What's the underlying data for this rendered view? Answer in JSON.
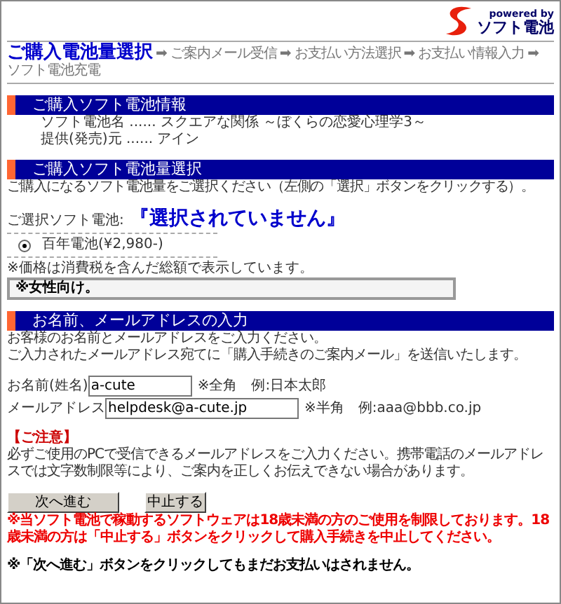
{
  "logo": {
    "tagline": "powered by",
    "name": "ソフト電池"
  },
  "breadcrumb": [
    {
      "label": "ご購入電池量選択",
      "selected": true
    },
    {
      "label": "ご案内メール受信",
      "selected": false,
      "arrow": "➡"
    },
    {
      "label": "お支払い方法選択",
      "selected": false,
      "arrow": "➡"
    },
    {
      "label": "お支払い情報入力",
      "selected": false,
      "arrow": "➡"
    },
    {
      "label": "ソフト電池充電",
      "selected": false,
      "arrow": "➡"
    }
  ],
  "product_info": {
    "title": "ご購入ソフト電池情報",
    "lines": [
      "ソフト電池名 ...... スクエアな関係 ～ぼくらの恋愛心理学3～",
      "提供(発売)元 ...... アイン"
    ]
  },
  "amount_selection": {
    "title": "ご購入ソフト電池量選択",
    "instruction": "ご購入になるソフト電池量をご選択ください（左側の「選択」ボタンをクリックする）。",
    "selected_label": "ご選択ソフト電池:",
    "selected_value": "『選択されていません』",
    "options": [
      {
        "label": "百年電池(¥2,980-)",
        "selected": true
      }
    ],
    "note": "※価格は消費税を含んだ総額で表示しています。",
    "remark": "※女性向け。"
  },
  "contact": {
    "title": "お名前、メールアドレスの入力",
    "intro": [
      "お客様のお名前とメールアドレスをご入力ください。",
      "ご入力されたメールアドレス宛てに「購入手続きのご案内メール」を送信いたします。"
    ],
    "fields": [
      {
        "label": "お名前(姓名)",
        "value": "a-cute",
        "hint": "※全角　例:日本太郎"
      },
      {
        "label": "メールアドレス",
        "value": "helpdesk@a-cute.jp",
        "hint": "※半角　例:aaa@bbb.co.jp"
      }
    ],
    "caution_title": "【ご注意】",
    "caution": "必ずご使用のPCで受信できるメールアドレスをご入力ください。携帯電話のメールアドレスでは文字数制限等により、ご案内を正しくお伝えできない場合があります。"
  },
  "buttons": [
    "次へ進む",
    "中止する"
  ],
  "warning": "※当ソフト電池で稼動するソフトウェアは18歳未満の方のご使用を制限しております。18歳未満の方は「中止する」ボタンをクリックして購入手続きを中止してください。",
  "footer_note": "※「次へ進む」ボタンをクリックしてもまだお支払いはされません。"
}
